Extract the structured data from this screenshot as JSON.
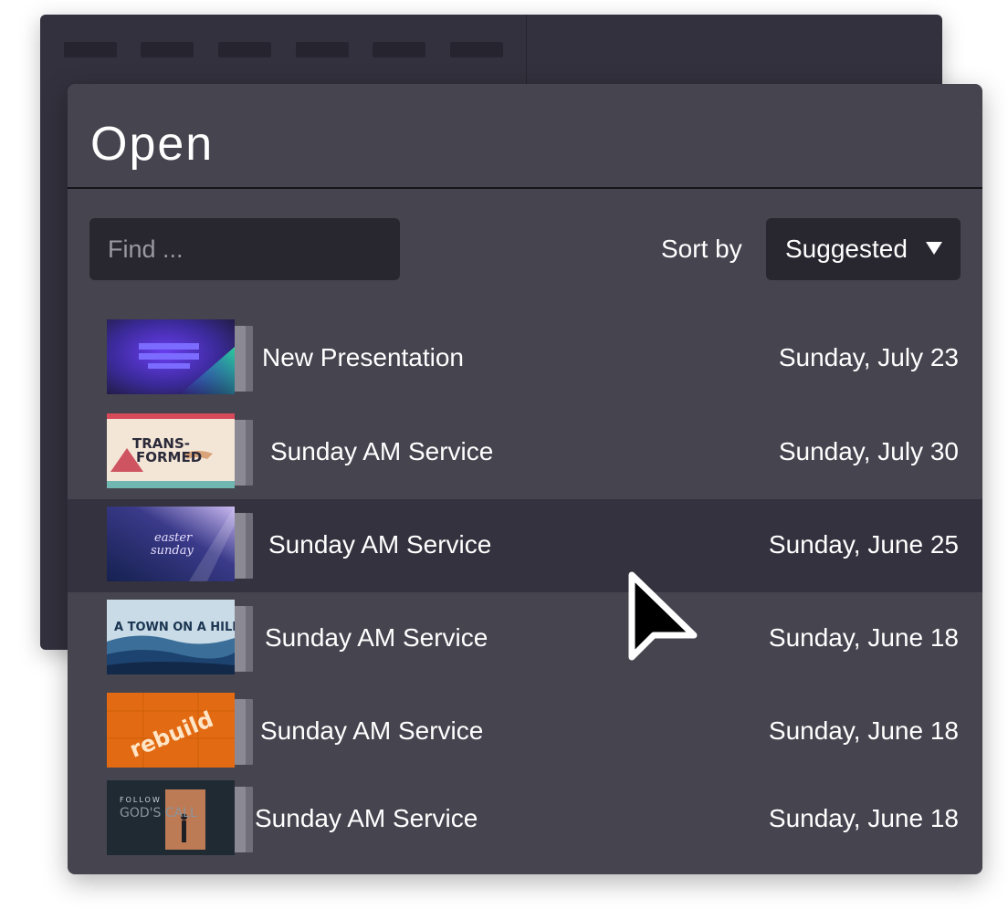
{
  "dialog": {
    "title": "Open"
  },
  "search": {
    "placeholder": "Find ..."
  },
  "sort": {
    "label": "Sort by",
    "selected": "Suggested"
  },
  "files": [
    {
      "name": "New Presentation",
      "date": "Sunday, July 23",
      "thumbnail": "new-presentation-thumbnail",
      "selected": false
    },
    {
      "name": "Sunday AM Service",
      "date": "Sunday, July 30",
      "thumbnail": "transformed-thumbnail",
      "selected": false
    },
    {
      "name": "Sunday AM Service",
      "date": "Sunday, June 25",
      "thumbnail": "easter-sunday-thumbnail",
      "selected": true
    },
    {
      "name": "Sunday AM Service",
      "date": "Sunday, June 18",
      "thumbnail": "a-town-on-a-hill-thumbnail",
      "selected": false
    },
    {
      "name": "Sunday AM Service",
      "date": "Sunday, June 18",
      "thumbnail": "rebuild-thumbnail",
      "selected": false
    },
    {
      "name": "Sunday AM Service",
      "date": "Sunday, June 18",
      "thumbnail": "follow-gods-call-thumbnail",
      "selected": false
    }
  ],
  "thumbnail_text": {
    "transformed_line1": "TRANS-",
    "transformed_line2": "FORMED",
    "easter_line1": "easter",
    "easter_line2": "sunday",
    "town": "A TOWN ON A HILL",
    "rebuild": "rebuild",
    "follow": "FOLLOW",
    "gods_call": "GOD'S CALL"
  },
  "colors": {
    "dialog_bg": "#45444f",
    "background_window": "#32313d",
    "input_bg": "#28272f",
    "selected_row_bg": "#33323e",
    "text": "#ffffff"
  }
}
